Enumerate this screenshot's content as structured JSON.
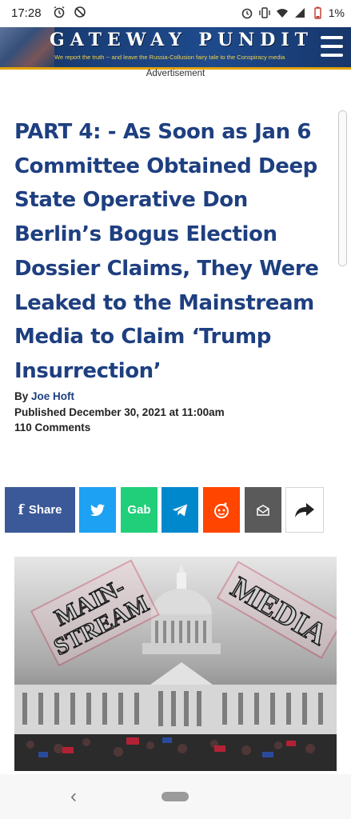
{
  "status_bar": {
    "time": "17:28",
    "battery_percent": "1%",
    "icons_left": [
      "alarm-icon",
      "disabled-sync-icon"
    ],
    "icons_right": [
      "alarm-icon",
      "vibrate-icon",
      "wifi-icon",
      "signal-icon",
      "battery-icon"
    ]
  },
  "header": {
    "title": "GATEWAY PUNDIT",
    "tagline": "We report the truth -- and leave the Russia-Collusion fairy tale to the Conspiracy media",
    "menu_icon": "hamburger-menu-icon",
    "colors": {
      "background": "#1e4a8c",
      "accent": "#e3a200",
      "tagline": "#f2d24a"
    }
  },
  "ad": {
    "label": "Advertisement"
  },
  "article": {
    "title": "PART 4: - As Soon as Jan 6 Committee Obtained Deep State Operative Don Berlin’s Bogus Election Dossier Claims, They Were Leaked to the Mainstream Media to Claim ‘Trump Insurrection’",
    "by_prefix": "By ",
    "author": "Joe Hoft",
    "published": "Published December 30, 2021 at 11:00am",
    "comments": "110 Comments",
    "title_color": "#1e3f80"
  },
  "share_buttons": [
    {
      "id": "facebook",
      "label": "Share",
      "icon": "facebook-icon",
      "color": "#3b5998"
    },
    {
      "id": "twitter",
      "label": "",
      "icon": "twitter-icon",
      "color": "#1da1f2"
    },
    {
      "id": "gab",
      "label": "Gab",
      "icon": "gab-icon",
      "color": "#21cf7a"
    },
    {
      "id": "telegram",
      "label": "",
      "icon": "telegram-icon",
      "color": "#0088cc"
    },
    {
      "id": "reddit",
      "label": "",
      "icon": "reddit-icon",
      "color": "#ff4500"
    },
    {
      "id": "email",
      "label": "",
      "icon": "email-icon",
      "color": "#5a5a5a"
    },
    {
      "id": "more",
      "label": "",
      "icon": "share-arrow-icon",
      "color": "#ffffff"
    }
  ],
  "image": {
    "stamp_left": [
      "MAIN-",
      "STREAM"
    ],
    "stamp_right": "MEDIA",
    "stamp_color": "#c3304a"
  },
  "nav": {
    "back_icon": "back-chevron-icon",
    "home_icon": "home-pill-icon"
  }
}
